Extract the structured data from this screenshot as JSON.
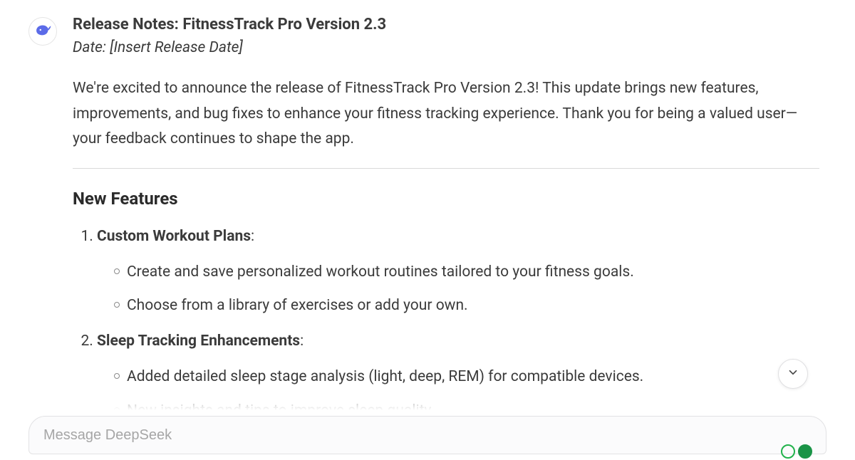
{
  "message": {
    "title": "Release Notes: FitnessTrack Pro Version 2.3",
    "date_line": "Date: [Insert Release Date]",
    "intro": "We're excited to announce the release of FitnessTrack Pro Version 2.3! This update brings new features, improvements, and bug fixes to enhance your fitness tracking experience. Thank you for being a valued user—your feedback continues to shape the app.",
    "section_heading": "New Features",
    "features": [
      {
        "title": "Custom Workout Plans",
        "points": [
          "Create and save personalized workout routines tailored to your fitness goals.",
          "Choose from a library of exercises or add your own."
        ]
      },
      {
        "title": "Sleep Tracking Enhancements",
        "points": [
          "Added detailed sleep stage analysis (light, deep, REM) for compatible devices.",
          "New insights and tips to improve sleep quality"
        ]
      }
    ]
  },
  "composer": {
    "placeholder": "Message DeepSeek"
  }
}
